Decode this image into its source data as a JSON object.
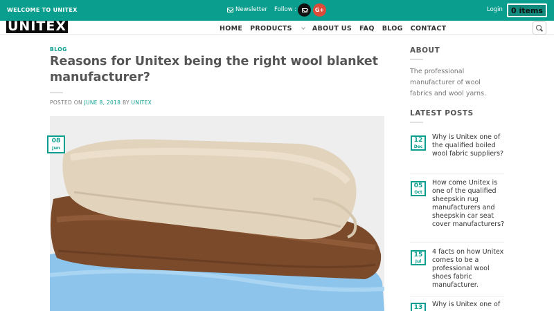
{
  "topbar": {
    "welcome": "WELCOME TO UNITEX",
    "newsletter": "Newsletter",
    "follow": "Follow :",
    "login": "Login",
    "cart": "0 items"
  },
  "header": {
    "logo": "UNITEX",
    "nav": [
      "HOME",
      "PRODUCTS",
      "ABOUT US",
      "FAQ",
      "BLOG",
      "CONTACT"
    ]
  },
  "article": {
    "category": "BLOG",
    "title": "Reasons for Unitex being the right wool blanket manufacturer?",
    "posted_on": "POSTED ON",
    "date": "JUNE 8, 2018",
    "by": "BY",
    "author": "UNITEX",
    "badge_day": "08",
    "badge_month": "Jun"
  },
  "sidebar": {
    "about_title": "ABOUT",
    "about_text": "The professional manufacturer of wool fabrics and wool yarns.",
    "latest_title": "LATEST POSTS",
    "posts": [
      {
        "day": "12",
        "month": "Dec",
        "title": "Why is Unitex one of the qualified boiled wool fabric suppliers?"
      },
      {
        "day": "05",
        "month": "Oct",
        "title": "How come Unitex is one of the qualified sheepskin rug manufacturers and sheepskin car seat cover manufacturers?"
      },
      {
        "day": "15",
        "month": "Jul",
        "title": "4 facts on how Unitex comes to be a professional wool shoes fabric manufacturer."
      },
      {
        "day": "13",
        "month": "",
        "title": "Why is Unitex one of"
      }
    ]
  },
  "colors": {
    "accent": "#0a9e8f",
    "topbar_bg": "#0a9e8f"
  }
}
